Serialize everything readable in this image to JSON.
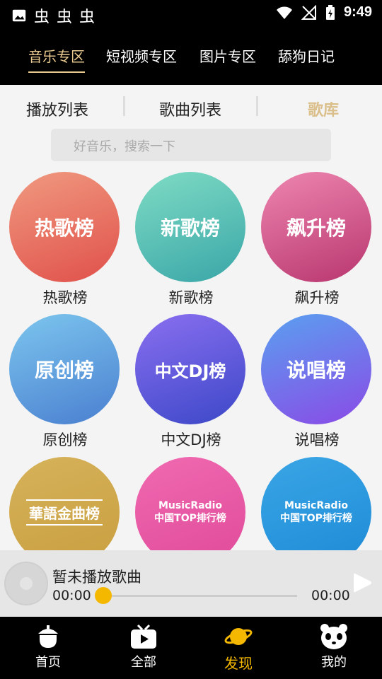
{
  "status": {
    "time": "9:49",
    "left_glyphs": [
      "虫",
      "虫",
      "虫"
    ]
  },
  "top_tabs": [
    {
      "label": "音乐专区",
      "active": true
    },
    {
      "label": "短视频专区",
      "active": false
    },
    {
      "label": "图片专区",
      "active": false
    },
    {
      "label": "舔狗日记",
      "active": false
    }
  ],
  "sub_tabs": [
    {
      "label": "播放列表",
      "active": false
    },
    {
      "label": "歌曲列表",
      "active": false
    },
    {
      "label": "歌库",
      "active": true
    }
  ],
  "search": {
    "placeholder": "好音乐，搜索一下"
  },
  "charts": [
    {
      "circle_text": "热歌榜",
      "label": "热歌榜",
      "color_a": "#f09a80",
      "color_b": "#e0504a"
    },
    {
      "circle_text": "新歌榜",
      "label": "新歌榜",
      "color_a": "#7fdcc4",
      "color_b": "#3aa6a8"
    },
    {
      "circle_text": "飙升榜",
      "label": "飙升榜",
      "color_a": "#ee86b0",
      "color_b": "#b8366e"
    },
    {
      "circle_text": "原创榜",
      "label": "原创榜",
      "color_a": "#7cc6ee",
      "color_b": "#4a7fd0"
    },
    {
      "circle_text": "中文DJ榜",
      "label": "中文DJ榜",
      "color_a": "#8a6ff0",
      "color_b": "#3c48c8"
    },
    {
      "circle_text": "说唱榜",
      "label": "说唱榜",
      "color_a": "#5aa0f0",
      "color_b": "#8a4ae6"
    },
    {
      "circle_text": "華語金曲榜",
      "label": "",
      "color_a": "#d6b25a",
      "color_b": "#c99f40"
    },
    {
      "circle_text": "MusicRadio",
      "circle_sub": "中国TOP排行榜",
      "label": "",
      "color_a": "#f06ab0",
      "color_b": "#e04a9a"
    },
    {
      "circle_text": "MusicRadio",
      "circle_sub": "中国TOP排行榜",
      "label": "",
      "color_a": "#3aa6e6",
      "color_b": "#1e8ad6"
    }
  ],
  "player": {
    "song": "暂未播放歌曲",
    "current": "00:00",
    "total": "00:00",
    "progress": 0
  },
  "bottom_nav": [
    {
      "label": "首页",
      "icon": "acorn-icon",
      "active": false
    },
    {
      "label": "全部",
      "icon": "tv-play-icon",
      "active": false
    },
    {
      "label": "发现",
      "icon": "planet-icon",
      "active": true
    },
    {
      "label": "我的",
      "icon": "panda-icon",
      "active": false
    }
  ]
}
